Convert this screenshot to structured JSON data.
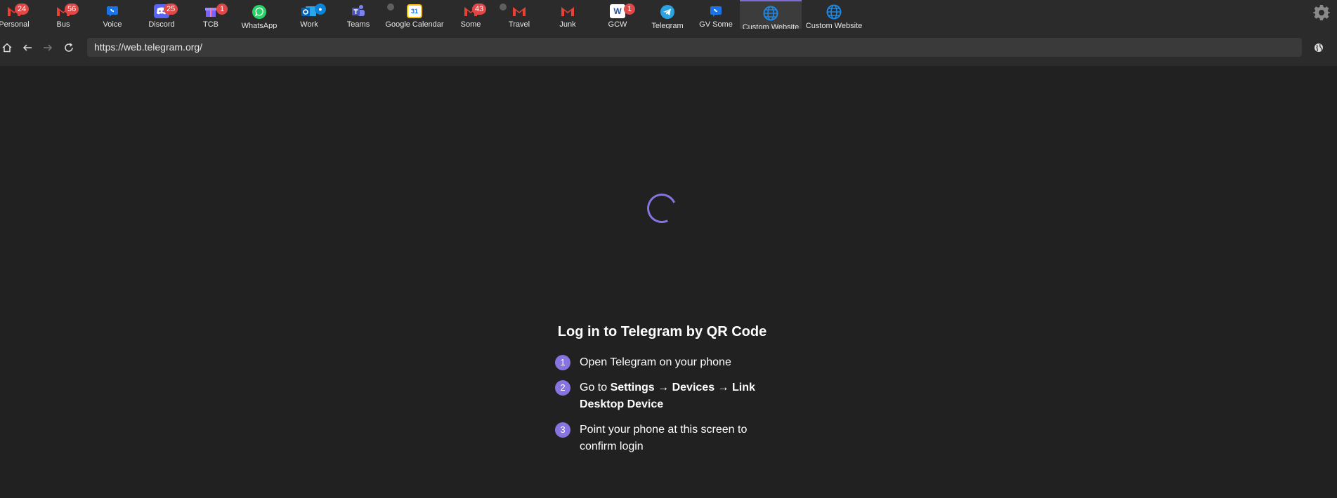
{
  "tabs": [
    {
      "label": "Personal",
      "badge": "24",
      "icon": "gmail-icon"
    },
    {
      "label": "Bus",
      "badge": "56",
      "icon": "gmail-icon"
    },
    {
      "label": "Voice",
      "icon": "google-voice-icon"
    },
    {
      "label": "Discord",
      "badge": "25",
      "icon": "discord-icon"
    },
    {
      "label": "TCB",
      "badge": "1",
      "icon": "gift-icon"
    },
    {
      "label": "WhatsApp",
      "icon": "whatsapp-icon"
    },
    {
      "label": "Work",
      "icon": "outlook-icon"
    },
    {
      "label": "Teams",
      "icon": "teams-icon"
    },
    {
      "label": "Google Calendar",
      "icon": "calendar-icon",
      "calendar_day": "31"
    },
    {
      "label": "Some",
      "badge": "43",
      "icon": "gmail-icon"
    },
    {
      "label": "Travel",
      "icon": "gmail-icon"
    },
    {
      "label": "Junk",
      "icon": "gmail-icon"
    },
    {
      "label": "GCW",
      "badge": "1",
      "icon": "word-icon",
      "icon_text": "W"
    },
    {
      "label": "Telegram",
      "icon": "telegram-icon"
    },
    {
      "label": "GV Some",
      "icon": "google-voice-icon"
    },
    {
      "label": "Custom Website",
      "icon": "globe-icon",
      "active": true
    },
    {
      "label": "Custom Website",
      "icon": "globe-icon"
    }
  ],
  "address_bar": {
    "url": "https://web.telegram.org/"
  },
  "login": {
    "title": "Log in to Telegram by QR Code",
    "steps": [
      {
        "number": "1",
        "text": "Open Telegram on your phone"
      },
      {
        "number": "2",
        "prefix": "Go to ",
        "settings": "Settings",
        "arrow1": " → ",
        "devices": "Devices",
        "arrow2": " → ",
        "link": "Link Desktop Device"
      },
      {
        "number": "3",
        "text": "Point your phone at this screen to confirm login"
      }
    ]
  },
  "colors": {
    "background": "#212121",
    "tabbar": "#2b2b2b",
    "accent": "#8774e1",
    "badge": "#e04747"
  }
}
